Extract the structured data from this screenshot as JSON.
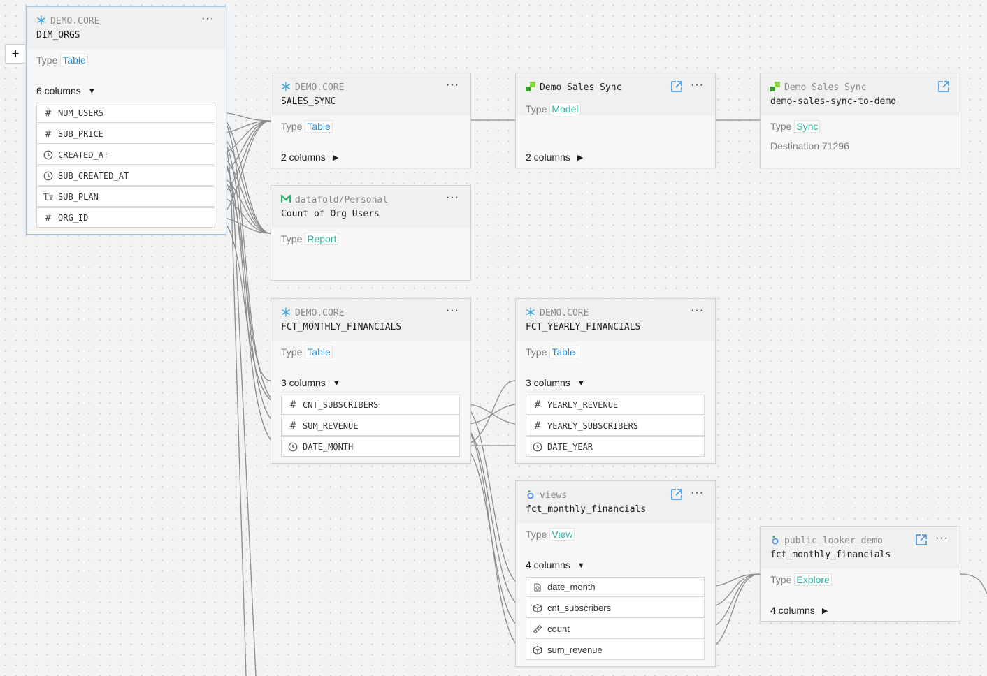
{
  "colors": {
    "accent_blue": "#2a8fd8",
    "accent_teal": "#2bb3a3",
    "edge": "#8c8c8c",
    "selected_border": "#9cc6ef"
  },
  "toolbar": {
    "add_label": "+"
  },
  "nodes": {
    "dim_orgs": {
      "source": "DEMO.CORE",
      "title": "DIM_ORGS",
      "type_label": "Type",
      "type_value": "Table",
      "icon": "snowflake-icon",
      "columns_label": "6 columns",
      "expanded": true,
      "columns": [
        {
          "name": "NUM_USERS",
          "icon": "hash-icon"
        },
        {
          "name": "SUB_PRICE",
          "icon": "hash-icon"
        },
        {
          "name": "CREATED_AT",
          "icon": "clock-icon"
        },
        {
          "name": "SUB_CREATED_AT",
          "icon": "clock-icon"
        },
        {
          "name": "SUB_PLAN",
          "icon": "text-type-icon"
        },
        {
          "name": "ORG_ID",
          "icon": "hash-icon"
        }
      ]
    },
    "sales_sync": {
      "source": "DEMO.CORE",
      "title": "SALES_SYNC",
      "type_label": "Type",
      "type_value": "Table",
      "icon": "snowflake-icon",
      "columns_label": "2 columns",
      "expanded": false
    },
    "demo_sales_sync_model": {
      "title": "Demo Sales Sync",
      "type_label": "Type",
      "type_value": "Model",
      "icon": "census-icon",
      "columns_label": "2 columns",
      "expanded": false
    },
    "demo_sales_sync_sync": {
      "source": "Demo Sales Sync",
      "title": "demo-sales-sync-to-demo",
      "type_label": "Type",
      "type_value": "Sync",
      "icon": "census-icon",
      "destination": "Destination 71296"
    },
    "count_of_org_users": {
      "source": "datafold/Personal",
      "title": "Count of Org Users",
      "type_label": "Type",
      "type_value": "Report",
      "icon": "mode-icon"
    },
    "fct_monthly_financials": {
      "source": "DEMO.CORE",
      "title": "FCT_MONTHLY_FINANCIALS",
      "type_label": "Type",
      "type_value": "Table",
      "icon": "snowflake-icon",
      "columns_label": "3 columns",
      "expanded": true,
      "columns": [
        {
          "name": "CNT_SUBSCRIBERS",
          "icon": "hash-icon"
        },
        {
          "name": "SUM_REVENUE",
          "icon": "hash-icon"
        },
        {
          "name": "DATE_MONTH",
          "icon": "clock-icon"
        }
      ]
    },
    "fct_yearly_financials": {
      "source": "DEMO.CORE",
      "title": "FCT_YEARLY_FINANCIALS",
      "type_label": "Type",
      "type_value": "Table",
      "icon": "snowflake-icon",
      "columns_label": "3 columns",
      "expanded": true,
      "columns": [
        {
          "name": "YEARLY_REVENUE",
          "icon": "hash-icon"
        },
        {
          "name": "YEARLY_SUBSCRIBERS",
          "icon": "hash-icon"
        },
        {
          "name": "DATE_YEAR",
          "icon": "clock-icon"
        }
      ]
    },
    "views_fct_monthly": {
      "source": "views",
      "title": "fct_monthly_financials",
      "type_label": "Type",
      "type_value": "View",
      "icon": "looker-icon",
      "columns_label": "4 columns",
      "expanded": true,
      "columns": [
        {
          "name": "date_month",
          "icon": "dimension-group-icon"
        },
        {
          "name": "cnt_subscribers",
          "icon": "measure-cube-icon"
        },
        {
          "name": "count",
          "icon": "ruler-icon"
        },
        {
          "name": "sum_revenue",
          "icon": "measure-cube-icon"
        }
      ]
    },
    "explore_fct_monthly": {
      "source": "public_looker_demo",
      "title": "fct_monthly_financials",
      "type_label": "Type",
      "type_value": "Explore",
      "icon": "looker-icon",
      "columns_label": "4 columns",
      "expanded": false
    }
  }
}
